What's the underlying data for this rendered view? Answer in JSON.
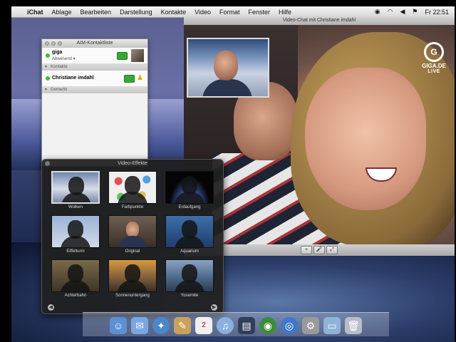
{
  "menubar": {
    "app": "iChat",
    "items": [
      "Ablage",
      "Bearbeiten",
      "Darstellung",
      "Kontakte",
      "Video",
      "Format",
      "Fenster",
      "Hilfe"
    ],
    "clock": "Fr 22:51"
  },
  "buddy_list": {
    "title": "AIM-Kontaktliste",
    "me": {
      "name": "giga",
      "status": "Abwesend ▾"
    },
    "groups": [
      "Kontakte",
      "Gemerkt"
    ],
    "contacts": [
      {
        "name": "Christiane imdahl"
      }
    ]
  },
  "video_chat": {
    "title": "Video-Chat mit Christiane imdahl",
    "toolbar_buttons": [
      "+",
      "🎤",
      "⤢"
    ],
    "overlay": {
      "brand": "GIGA.DE",
      "live": "LIVE",
      "logo_letter": "G"
    }
  },
  "effects": {
    "title": "Video-Effekte",
    "items": [
      {
        "label": "Wolken",
        "selected": true
      },
      {
        "label": "Farbpunkte",
        "selected": false
      },
      {
        "label": "Erdaufgang",
        "selected": false
      },
      {
        "label": "Eiffelturm",
        "selected": false
      },
      {
        "label": "Original",
        "selected": false
      },
      {
        "label": "Aquarium",
        "selected": false
      },
      {
        "label": "Achterbahn",
        "selected": false
      },
      {
        "label": "Sonnenuntergang",
        "selected": false
      },
      {
        "label": "Yosemite",
        "selected": false
      }
    ]
  },
  "dock": {
    "icons": [
      "finder-icon",
      "ichat-icon",
      "safari-icon",
      "mail-icon",
      "ical-icon",
      "itunes-icon",
      "iphoto-icon",
      "dvd-icon",
      "dashboard-icon",
      "system-preferences-icon",
      "folder-icon",
      "trash-icon"
    ]
  },
  "colors": {
    "accent_green": "#3dbb3d",
    "panel_bg": "#202020"
  }
}
